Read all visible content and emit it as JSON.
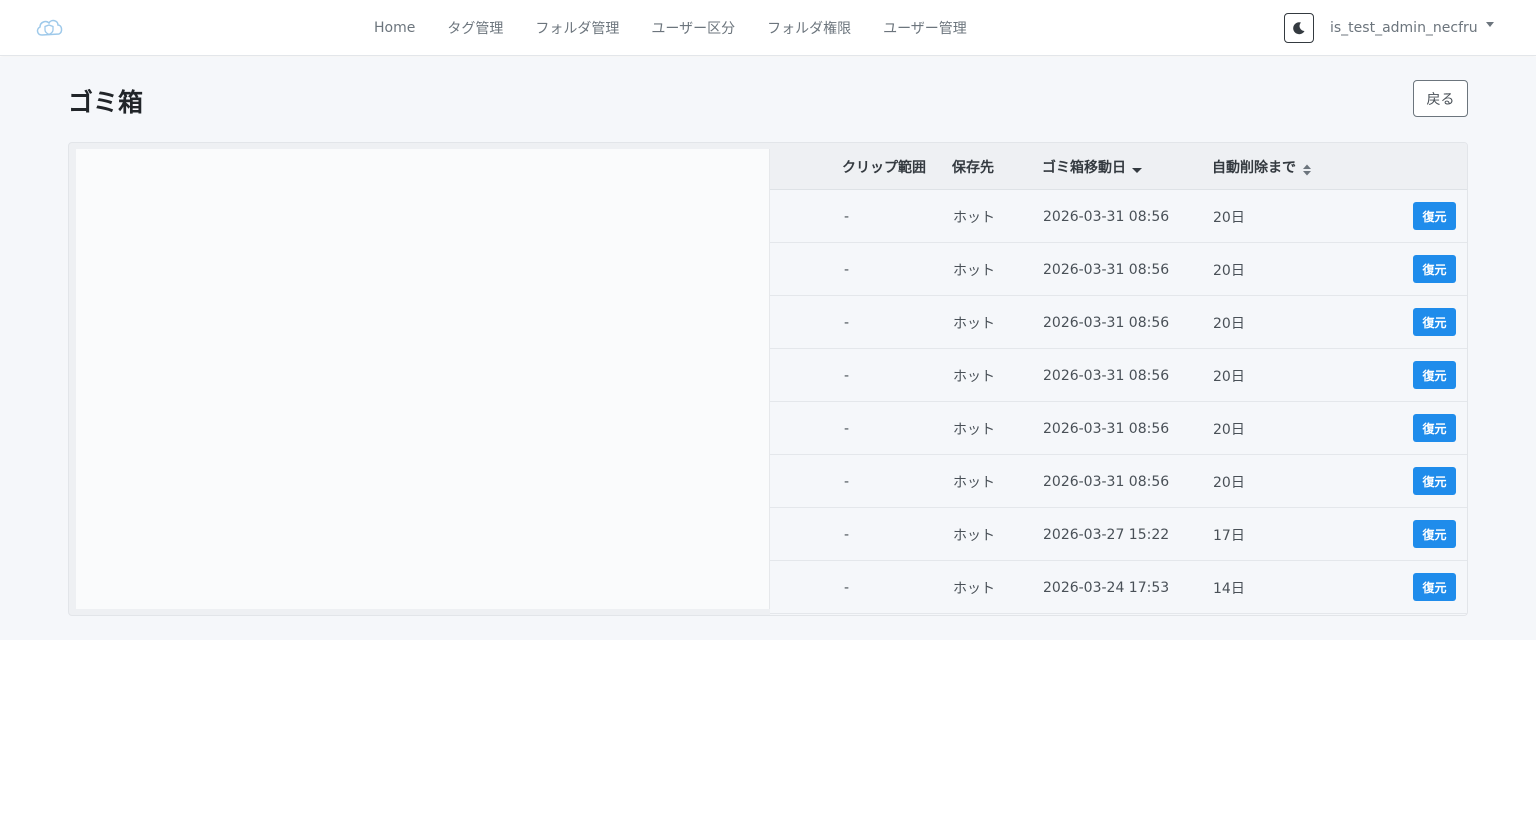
{
  "nav": {
    "logo_icon": "cloud-shield-icon",
    "links": [
      "Home",
      "タグ管理",
      "フォルダ管理",
      "ユーザー区分",
      "フォルダ権限",
      "ユーザー管理"
    ],
    "theme_icon": "moon-icon",
    "user_name": "is_test_admin_necfru"
  },
  "page": {
    "title": "ゴミ箱",
    "back_label": "戻る"
  },
  "table": {
    "headers": {
      "clip_range": "クリップ範囲",
      "storage": "保存先",
      "moved_date": "ゴミ箱移動日",
      "auto_delete": "自動削除まで"
    },
    "restore_label": "復元",
    "rows": [
      {
        "clip_range": "-",
        "storage": "ホット",
        "moved_date": "2026-03-31 08:56",
        "auto_delete": "20日"
      },
      {
        "clip_range": "-",
        "storage": "ホット",
        "moved_date": "2026-03-31 08:56",
        "auto_delete": "20日"
      },
      {
        "clip_range": "-",
        "storage": "ホット",
        "moved_date": "2026-03-31 08:56",
        "auto_delete": "20日"
      },
      {
        "clip_range": "-",
        "storage": "ホット",
        "moved_date": "2026-03-31 08:56",
        "auto_delete": "20日"
      },
      {
        "clip_range": "-",
        "storage": "ホット",
        "moved_date": "2026-03-31 08:56",
        "auto_delete": "20日"
      },
      {
        "clip_range": "-",
        "storage": "ホット",
        "moved_date": "2026-03-31 08:56",
        "auto_delete": "20日"
      },
      {
        "clip_range": "-",
        "storage": "ホット",
        "moved_date": "2026-03-27 15:22",
        "auto_delete": "17日"
      },
      {
        "clip_range": "-",
        "storage": "ホット",
        "moved_date": "2026-03-24 17:53",
        "auto_delete": "14日"
      }
    ]
  },
  "colors": {
    "accent": "#1f8ceb",
    "page_bg": "#f5f7fa"
  }
}
